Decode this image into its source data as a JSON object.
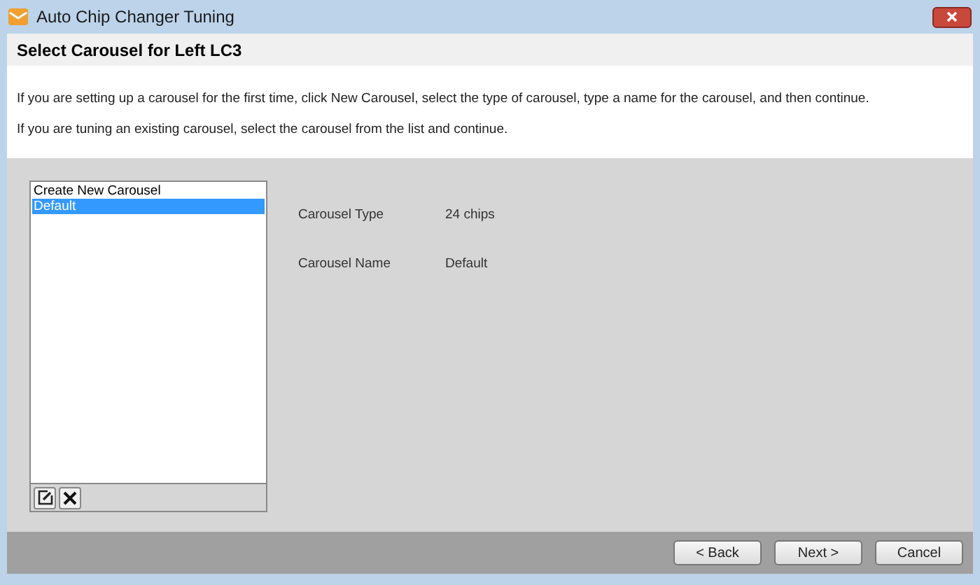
{
  "window": {
    "title": "Auto Chip Changer Tuning"
  },
  "header": {
    "title": "Select Carousel for Left LC3"
  },
  "instructions": [
    "If you are setting up a carousel for the first time, click New Carousel, select the type of carousel, type a name for the carousel, and then continue.",
    "If you are tuning an existing carousel, select the carousel from the list and continue."
  ],
  "carousel_list": [
    {
      "label": "Create New Carousel",
      "selected": false
    },
    {
      "label": "Default",
      "selected": true
    }
  ],
  "details": [
    {
      "label": "Carousel Type",
      "value": "24 chips"
    },
    {
      "label": "Carousel Name",
      "value": "Default"
    }
  ],
  "buttons": [
    "< Back",
    "Next >",
    "Cancel"
  ]
}
